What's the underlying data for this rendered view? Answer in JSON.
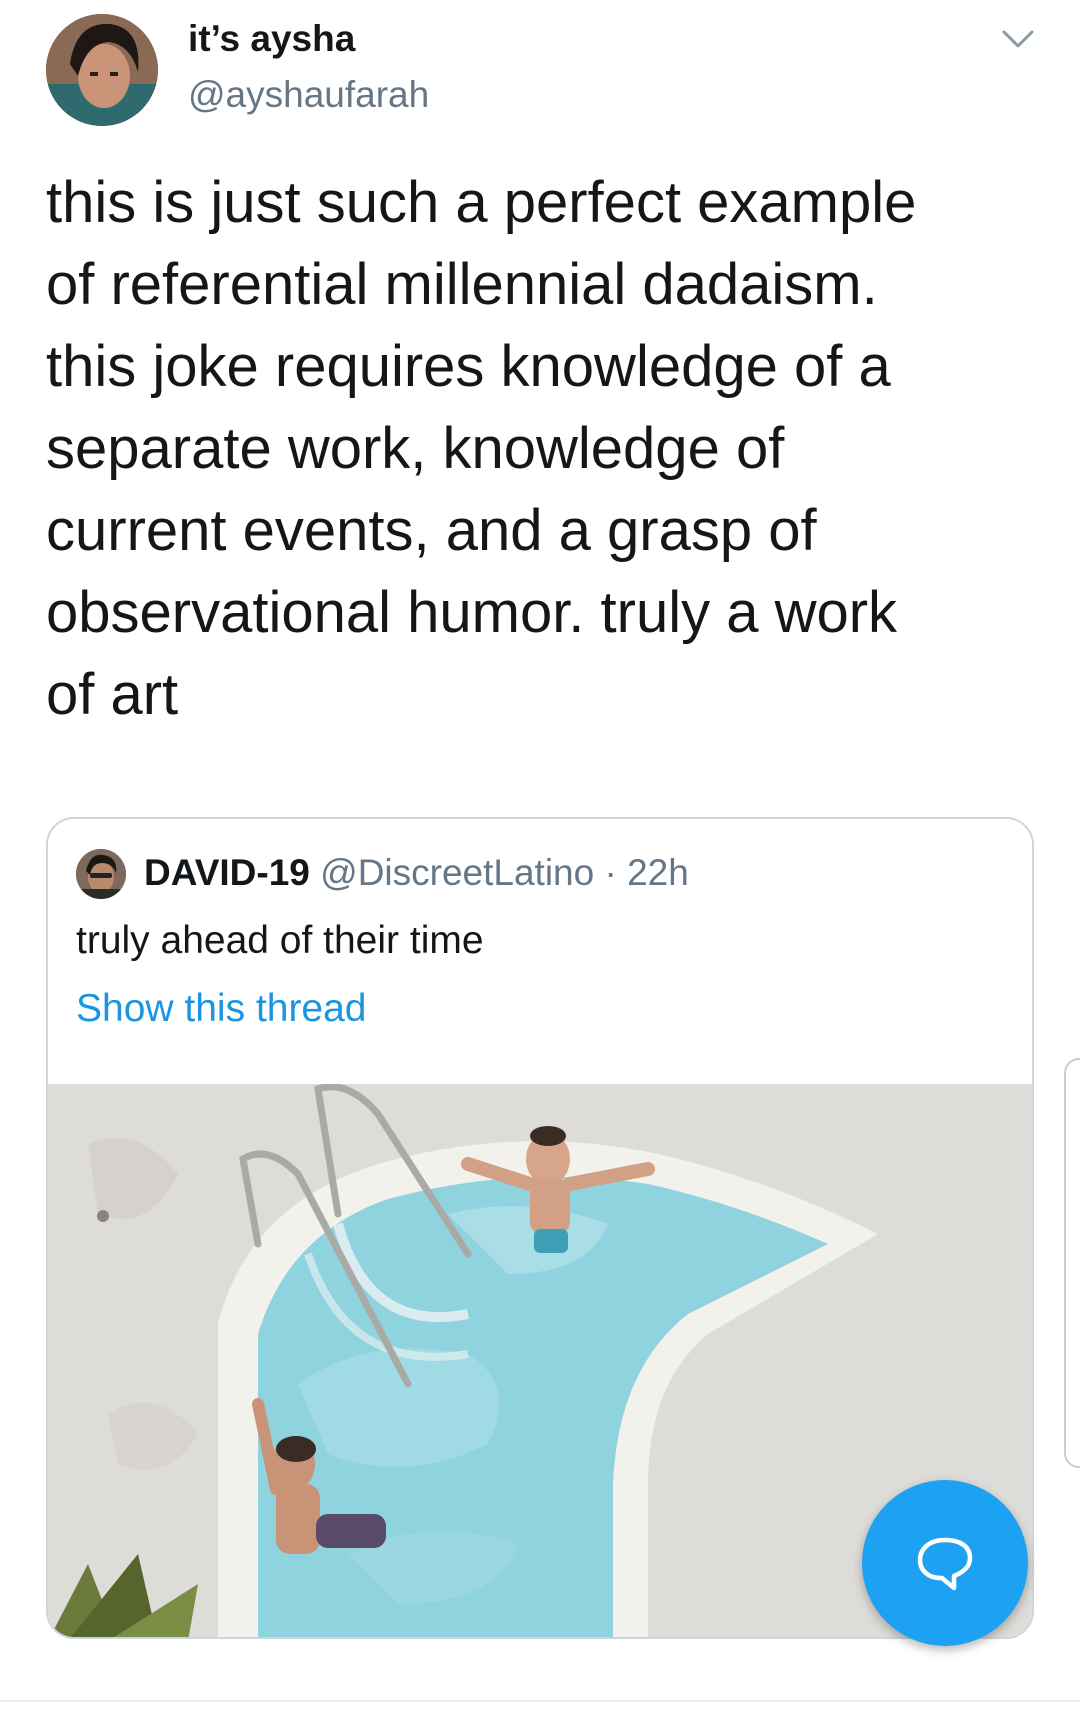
{
  "tweet": {
    "display_name": "it’s aysha",
    "handle": "@ayshaufarah",
    "text": "this is just such a perfect example\nof referential millennial dadaism.\nthis joke requires knowledge of a\nseparate work, knowledge of\ncurrent events, and a grasp of\nobservational humor. truly a work\nof art"
  },
  "quoted_tweet": {
    "display_name": "DAVID-19",
    "handle": "@DiscreetLatino",
    "separator": "·",
    "time": "22h",
    "text": "truly ahead of their time",
    "show_thread": "Show this thread"
  },
  "colors": {
    "link": "#1b95e0",
    "fab": "#1da1f2",
    "secondary_text": "#657786",
    "border": "#ccd6dd"
  },
  "icons": {
    "caret": "chevron-down-icon",
    "fab": "reply-bubble-icon"
  }
}
